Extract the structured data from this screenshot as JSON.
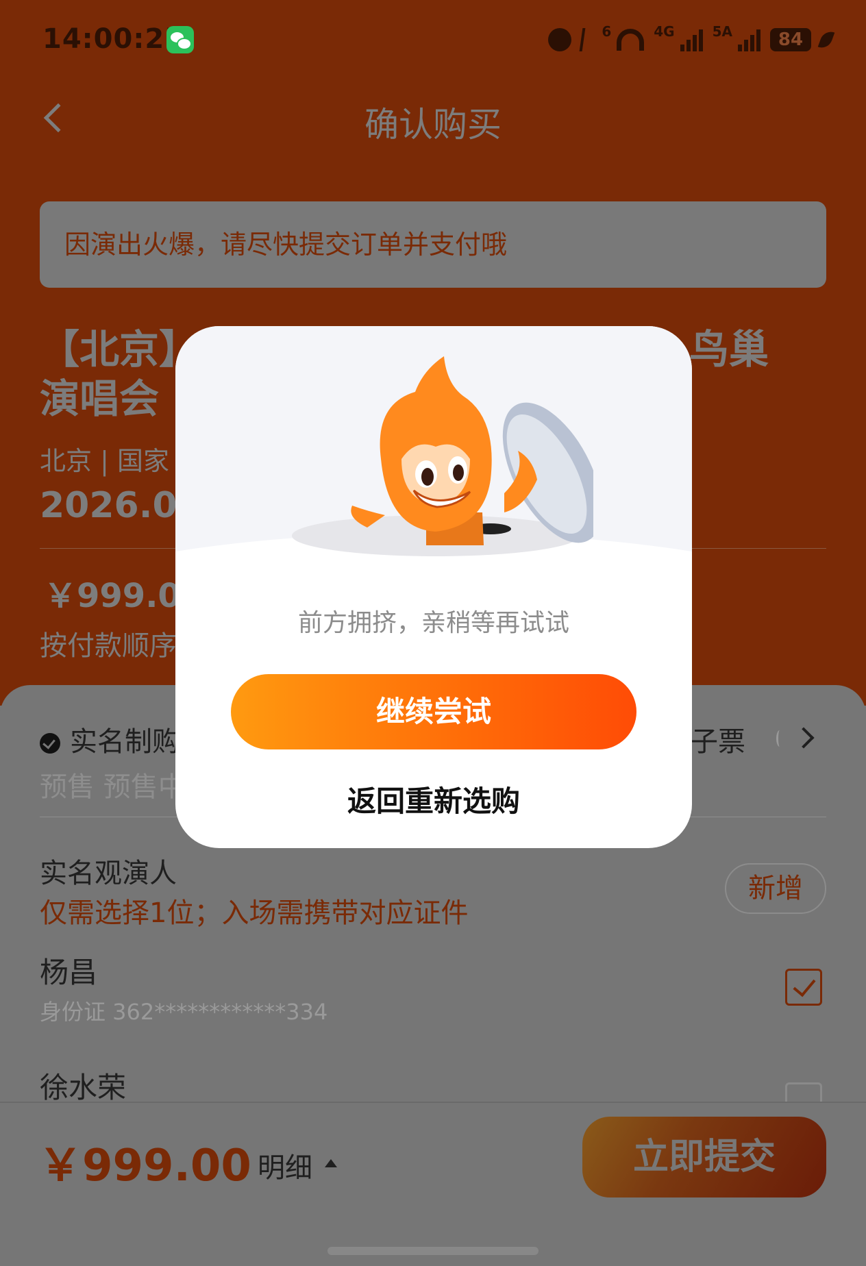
{
  "status_bar": {
    "time": "14:00:25",
    "battery": "84",
    "net_tag_1": "6",
    "net_tag_2": "4G",
    "net_tag_3": "5A"
  },
  "nav": {
    "title": "确认购买"
  },
  "notice": {
    "text": "因演出火爆，请尽快提交订单并支付哦"
  },
  "event": {
    "title_left_1": "【北京】",
    "title_right_1": "鸟巢",
    "title_line_2": "演唱会",
    "venue": "北京 | 国家",
    "date": "2026.09",
    "price": "￥999.00",
    "order_note": "按付款顺序"
  },
  "ticket_info": {
    "realname_label": "实名制购",
    "eticket_label": "子票",
    "presale": "预售 预售中"
  },
  "viewers": {
    "title": "实名观演人",
    "hint": "仅需选择1位；入场需携带对应证件",
    "add_label": "新增",
    "people": [
      {
        "name": "杨昌",
        "id": "身份证 362************334",
        "checked": true
      },
      {
        "name": "徐水荣",
        "checked": false
      }
    ]
  },
  "bottom": {
    "total": "￥999.00",
    "detail_label": "明细",
    "submit_label": "立即提交"
  },
  "modal": {
    "message": "前方拥挤，亲稍等再试试",
    "retry_label": "继续尝试",
    "reselect_label": "返回重新选购"
  },
  "colors": {
    "header": "#7a2a06",
    "overlay": "#767676",
    "accent_orange": "#ff6a08",
    "modal_bg": "#ffffff"
  }
}
